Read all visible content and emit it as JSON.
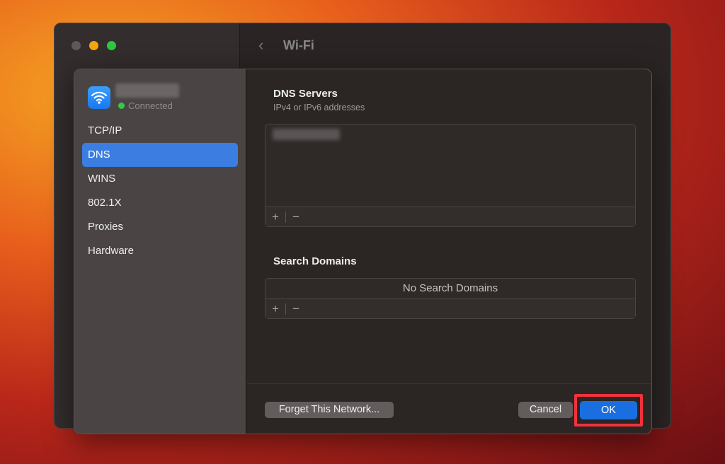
{
  "window": {
    "title": "Wi-Fi",
    "back_icon": "chevron-left-icon"
  },
  "sidebar": {
    "network_status": "Connected",
    "items": [
      {
        "label": "TCP/IP"
      },
      {
        "label": "DNS",
        "selected": true
      },
      {
        "label": "WINS"
      },
      {
        "label": "802.1X"
      },
      {
        "label": "Proxies"
      },
      {
        "label": "Hardware"
      }
    ]
  },
  "dns": {
    "title": "DNS Servers",
    "subtitle": "IPv4 or IPv6 addresses",
    "add": "+",
    "remove": "−"
  },
  "search": {
    "title": "Search Domains",
    "empty": "No Search Domains",
    "add": "+",
    "remove": "−"
  },
  "footer": {
    "forget": "Forget This Network...",
    "cancel": "Cancel",
    "ok": "OK"
  },
  "colors": {
    "accent": "#3b7de0",
    "ok": "#1a6fe0",
    "highlight": "#f0323c",
    "connected": "#2fcc4a"
  }
}
